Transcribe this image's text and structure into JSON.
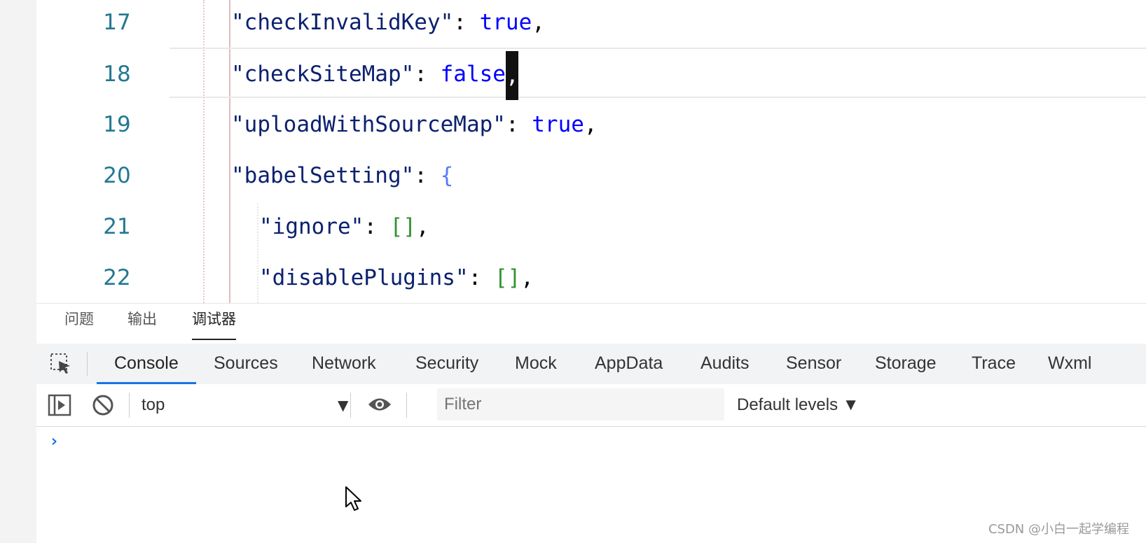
{
  "editor": {
    "lines": [
      {
        "num": "17",
        "key": "\"checkInvalidKey\"",
        "colon": ": ",
        "value": "true",
        "trail": ","
      },
      {
        "num": "18",
        "key": "\"checkSiteMap\"",
        "colon": ": ",
        "value": "false",
        "trail": ","
      },
      {
        "num": "19",
        "key": "\"uploadWithSourceMap\"",
        "colon": ": ",
        "value": "true",
        "trail": ","
      },
      {
        "num": "20",
        "key": "\"babelSetting\"",
        "colon": ": ",
        "value": "{",
        "trail": ""
      },
      {
        "num": "21",
        "key": "\"ignore\"",
        "colon": ": ",
        "value": "[]",
        "trail": ","
      },
      {
        "num": "22",
        "key": "\"disablePlugins\"",
        "colon": ": ",
        "value": "[]",
        "trail": ","
      }
    ]
  },
  "panel_tabs": [
    "问题",
    "输出",
    "调试器"
  ],
  "panel_active": "调试器",
  "devtools_tabs": [
    "Console",
    "Sources",
    "Network",
    "Security",
    "Mock",
    "AppData",
    "Audits",
    "Sensor",
    "Storage",
    "Trace",
    "Wxml"
  ],
  "devtools_active": "Console",
  "toolbar": {
    "context": "top",
    "filter_placeholder": "Filter",
    "levels": "Default levels ▼"
  },
  "console": {
    "prompt": "›"
  },
  "watermark": "CSDN @小白一起学编程",
  "colors": {
    "accent": "#1a73e8",
    "line_number": "#237893",
    "string": "#0b216f",
    "keyword": "#0000ff"
  },
  "icons": [
    "inspect-element-icon",
    "sidebar-toggle-icon",
    "clear-console-icon",
    "eye-icon",
    "dropdown-caret-icon",
    "mouse-pointer-icon"
  ]
}
